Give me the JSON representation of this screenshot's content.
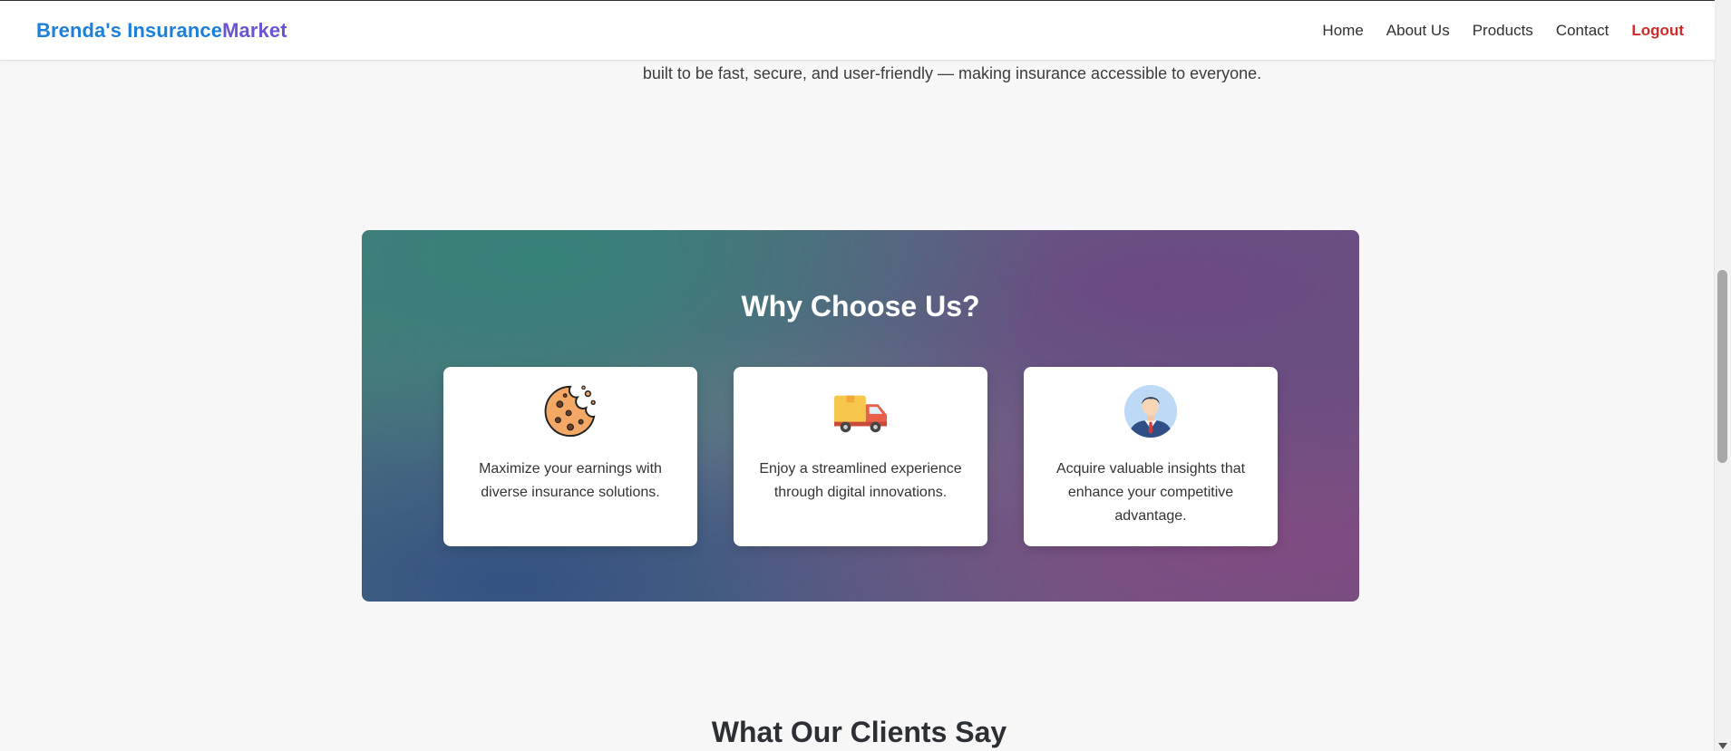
{
  "header": {
    "brand_part1": "Brenda's Insurance",
    "brand_part2": "Market",
    "nav": {
      "home": "Home",
      "about": "About Us",
      "products": "Products",
      "contact": "Contact",
      "logout": "Logout"
    },
    "colors": {
      "brand_blue": "#1e7fd8",
      "brand_purple": "#6c52d6",
      "logout_red": "#d12a2a"
    }
  },
  "intro": {
    "text": "built to be fast, secure, and user-friendly — making insurance accessible to everyone."
  },
  "why": {
    "title": "Why Choose Us?",
    "cards": [
      {
        "icon": "cookie-icon",
        "text": "Maximize your earnings with diverse insurance solutions."
      },
      {
        "icon": "delivery-truck-icon",
        "text": "Enjoy a streamlined experience through digital innovations."
      },
      {
        "icon": "businessman-avatar-icon",
        "text": "Acquire valuable insights that enhance your competitive advantage."
      }
    ]
  },
  "clients": {
    "title": "What Our Clients Say"
  }
}
